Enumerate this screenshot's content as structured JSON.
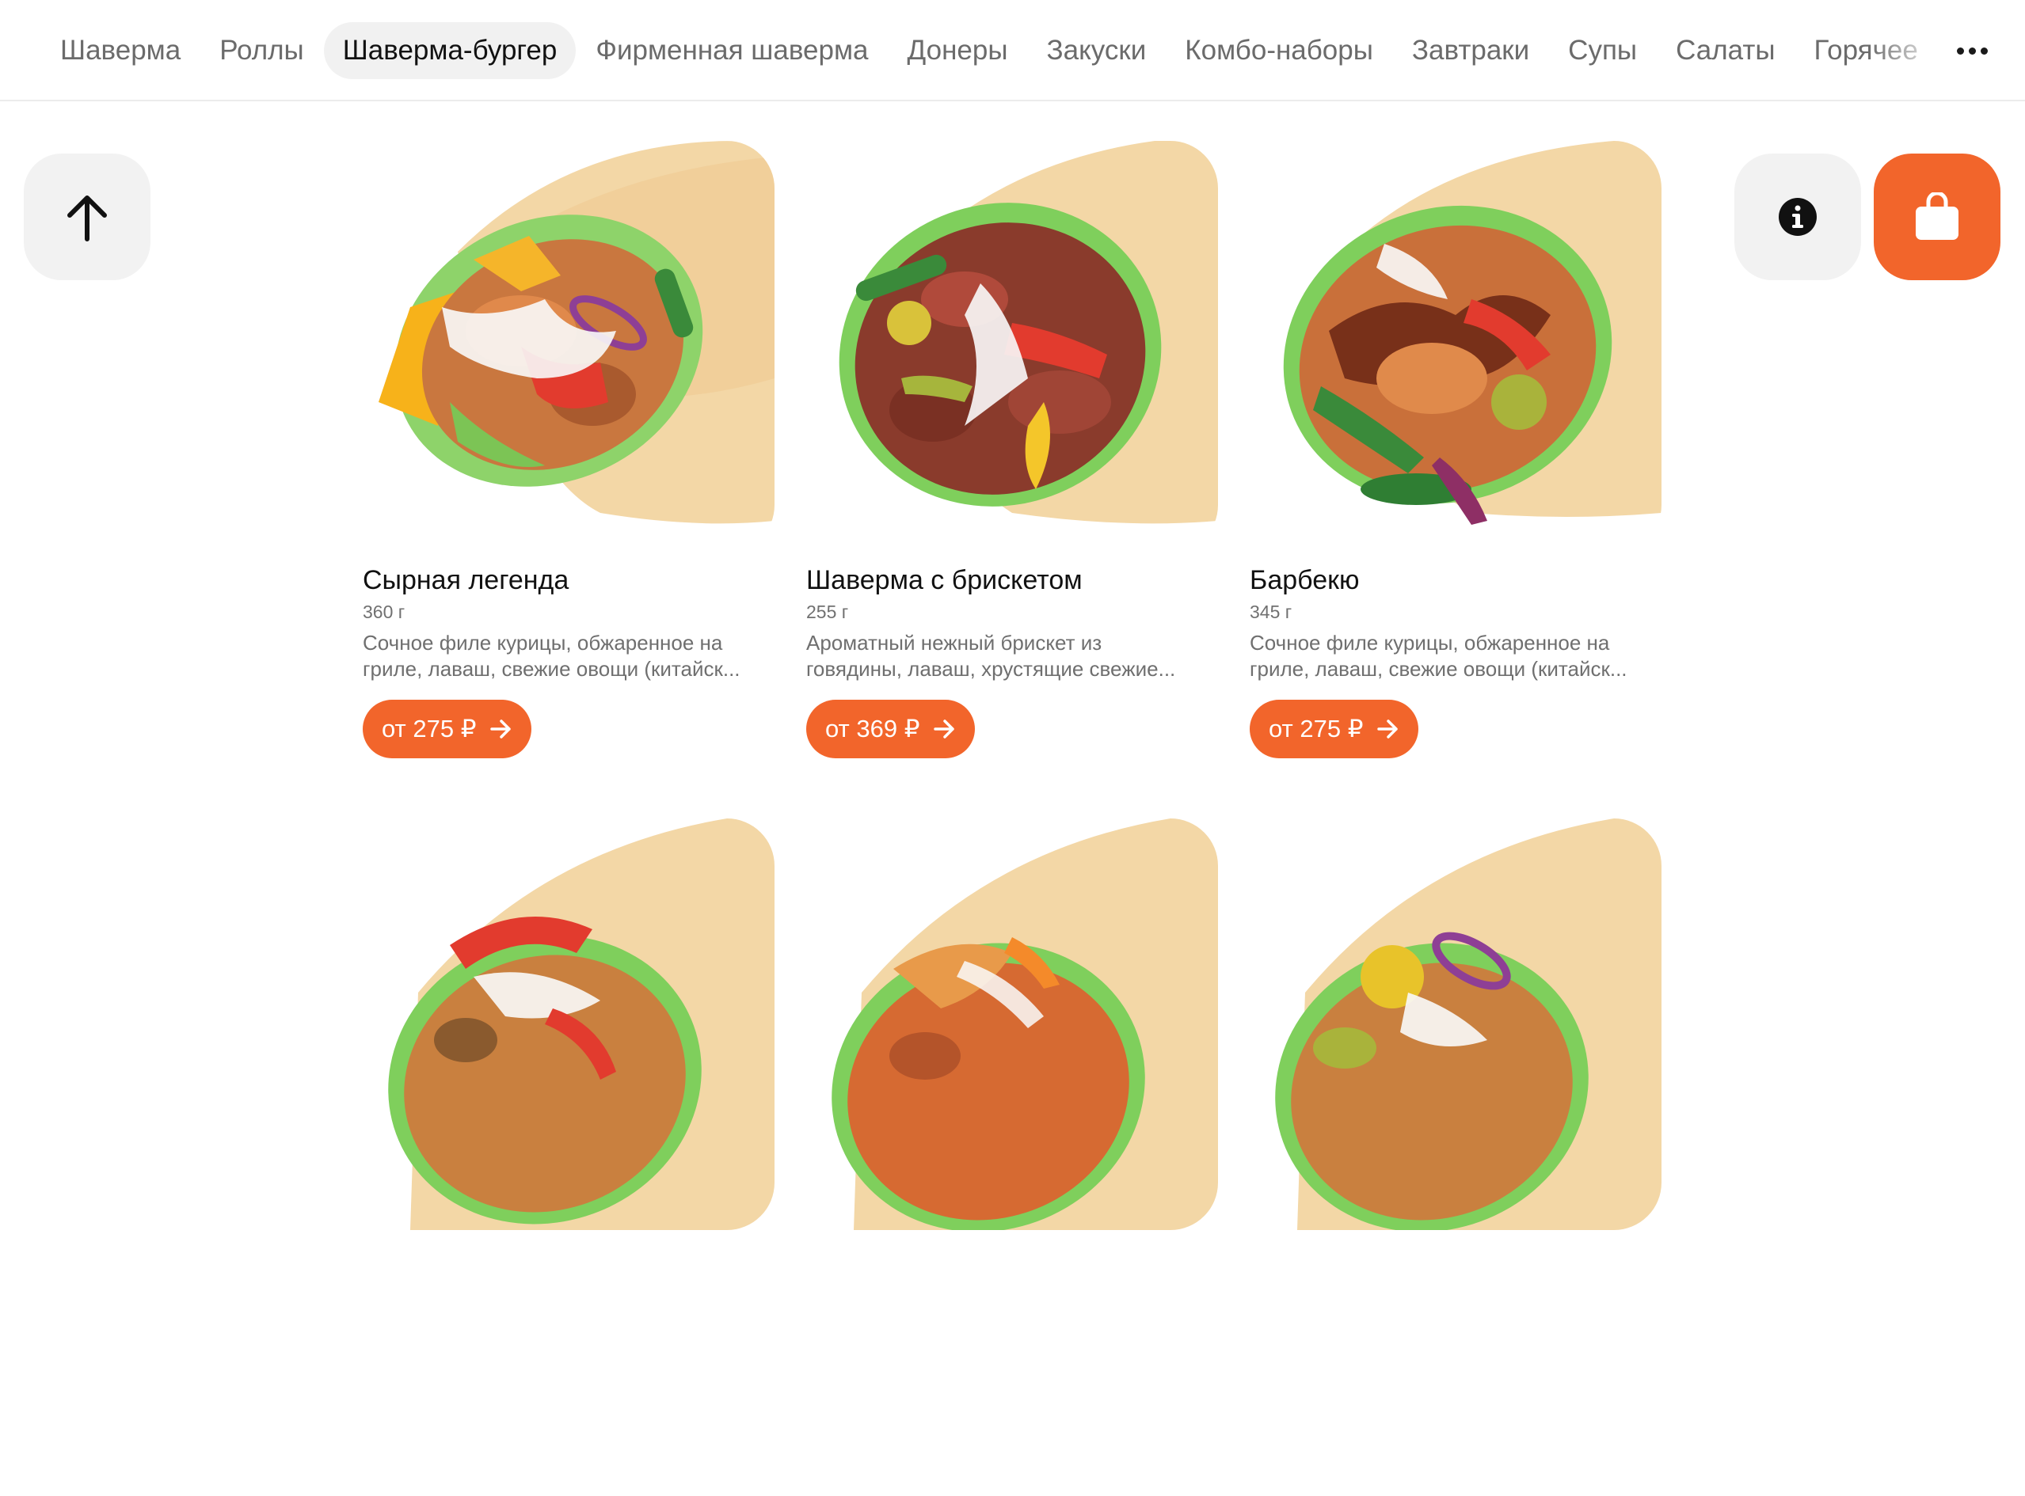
{
  "nav": {
    "categories": [
      {
        "label": "Шаверма",
        "active": false
      },
      {
        "label": "Роллы",
        "active": false
      },
      {
        "label": "Шаверма-бургер",
        "active": true
      },
      {
        "label": "Фирменная шаверма",
        "active": false
      },
      {
        "label": "Донеры",
        "active": false
      },
      {
        "label": "Закуски",
        "active": false
      },
      {
        "label": "Комбо-наборы",
        "active": false
      },
      {
        "label": "Завтраки",
        "active": false
      },
      {
        "label": "Супы",
        "active": false
      },
      {
        "label": "Салаты",
        "active": false
      },
      {
        "label": "Горячее",
        "active": false
      }
    ],
    "more_icon": "more-dots-icon"
  },
  "buttons": {
    "scroll_top_icon": "arrow-up-icon",
    "info_icon": "info-icon",
    "cart_icon": "shopping-bag-icon"
  },
  "colors": {
    "accent": "#f2652b",
    "chip_bg": "#f1f1f1",
    "text_primary": "#111111",
    "text_secondary": "#6f6f6f"
  },
  "products": [
    {
      "name": "Сырная легенда",
      "weight": "360 г",
      "desc_line1": "Сочное филе курицы, обжаренное на",
      "desc_line2": "гриле, лаваш, свежие овощи (китайск...",
      "price": "от 275 ₽"
    },
    {
      "name": "Шаверма с брискетом",
      "weight": "255 г",
      "desc_line1": "Ароматный нежный брискет из",
      "desc_line2": "говядины, лаваш, хрустящие свежие...",
      "price": "от 369 ₽"
    },
    {
      "name": "Барбекю",
      "weight": "345 г",
      "desc_line1": "Сочное филе курицы, обжаренное на",
      "desc_line2": "гриле, лаваш, свежие овощи (китайск...",
      "price": "от 275 ₽"
    },
    {
      "name": "",
      "weight": "",
      "desc_line1": "",
      "desc_line2": "",
      "price": ""
    },
    {
      "name": "",
      "weight": "",
      "desc_line1": "",
      "desc_line2": "",
      "price": ""
    },
    {
      "name": "",
      "weight": "",
      "desc_line1": "",
      "desc_line2": "",
      "price": ""
    }
  ]
}
